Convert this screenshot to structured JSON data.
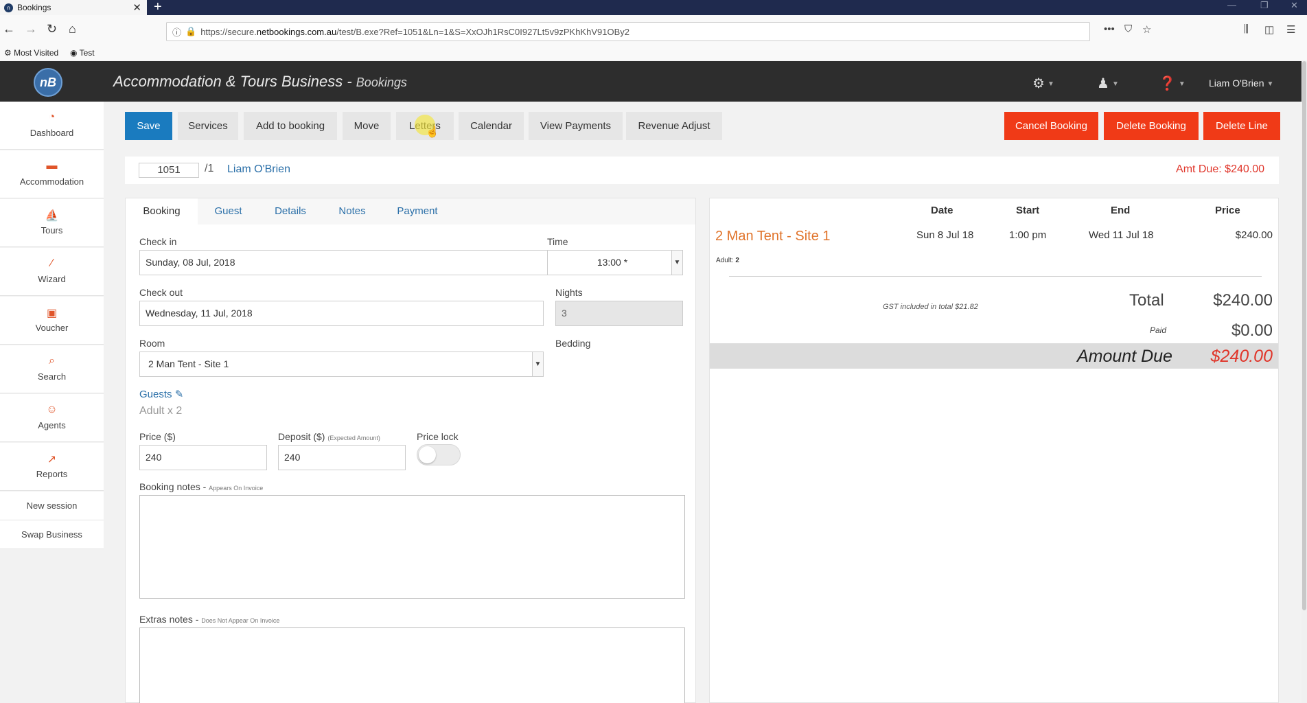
{
  "browser": {
    "tab_title": "Bookings",
    "tab_close": "✕",
    "new_tab": "+",
    "url_prefix": "https://secure.",
    "url_host": "netbookings.com.au",
    "url_path": "/test/B.exe?Ref=1051&Ln=1&S=XxOJh1RsC0I927Lt5v9zPKhKhV91OBy2",
    "bookmarks": [
      "Most Visited",
      "Test"
    ]
  },
  "header": {
    "title": "Accommodation & Tours Business",
    "separator": " - ",
    "subtitle": "Bookings",
    "user": "Liam O'Brien",
    "logo": "nB"
  },
  "sidebar": {
    "items": [
      {
        "label": "Dashboard",
        "icon": "dashboard-icon"
      },
      {
        "label": "Accommodation",
        "icon": "bed-icon"
      },
      {
        "label": "Tours",
        "icon": "tours-icon"
      },
      {
        "label": "Wizard",
        "icon": "wand-icon"
      },
      {
        "label": "Voucher",
        "icon": "gift-icon"
      },
      {
        "label": "Search",
        "icon": "search-icon"
      },
      {
        "label": "Agents",
        "icon": "agent-icon"
      },
      {
        "label": "Reports",
        "icon": "chart-icon"
      }
    ],
    "links": [
      "New session",
      "Swap Business"
    ]
  },
  "toolbar": {
    "save": "Save",
    "services": "Services",
    "add_to_booking": "Add to booking",
    "move": "Move",
    "letters": "Letters",
    "calendar": "Calendar",
    "view_payments": "View Payments",
    "revenue_adjust": "Revenue Adjust",
    "cancel_booking": "Cancel Booking",
    "delete_booking": "Delete Booking",
    "delete_line": "Delete Line"
  },
  "booking": {
    "number": "1051",
    "line": "/1",
    "guest_name": "Liam O'Brien",
    "amt_due": "Amt Due: $240.00"
  },
  "form": {
    "tabs": [
      "Booking",
      "Guest",
      "Details",
      "Notes",
      "Payment"
    ],
    "check_in_label": "Check in",
    "check_in_value": "Sunday, 08 Jul, 2018",
    "time_label": "Time",
    "time_value": "13:00 *",
    "check_out_label": "Check out",
    "check_out_value": "Wednesday, 11 Jul, 2018",
    "nights_label": "Nights",
    "nights_value": "3",
    "room_label": "Room",
    "room_value": "2 Man Tent - Site 1",
    "bedding_label": "Bedding",
    "guests_label": "Guests",
    "guests_value": "Adult x 2",
    "price_label": "Price ($)",
    "price_value": "240",
    "deposit_label": "Deposit ($)",
    "deposit_hint": "(Expected Amount)",
    "deposit_value": "240",
    "price_lock_label": "Price lock",
    "booking_notes_label": "Booking notes - ",
    "booking_notes_hint": "Appears On Invoice",
    "extras_notes_label": "Extras notes - ",
    "extras_notes_hint": "Does Not Appear On Invoice"
  },
  "summary": {
    "headers": {
      "date": "Date",
      "start": "Start",
      "end": "End",
      "price": "Price"
    },
    "item": {
      "name": "2 Man Tent - Site 1",
      "date": "Sun 8 Jul 18",
      "start": "1:00 pm",
      "end": "Wed 11 Jul 18",
      "price": "$240.00",
      "adult_label": "Adult:",
      "adult_count": "2"
    },
    "gst": "GST included in total $21.82",
    "total_label": "Total",
    "total_value": "$240.00",
    "paid_label": "Paid",
    "paid_value": "$0.00",
    "due_label": "Amount Due",
    "due_value": "$240.00"
  },
  "colors": {
    "primary": "#1a7bbf",
    "danger": "#f03a17",
    "accent": "#e0732a",
    "link": "#2a6fa8"
  }
}
